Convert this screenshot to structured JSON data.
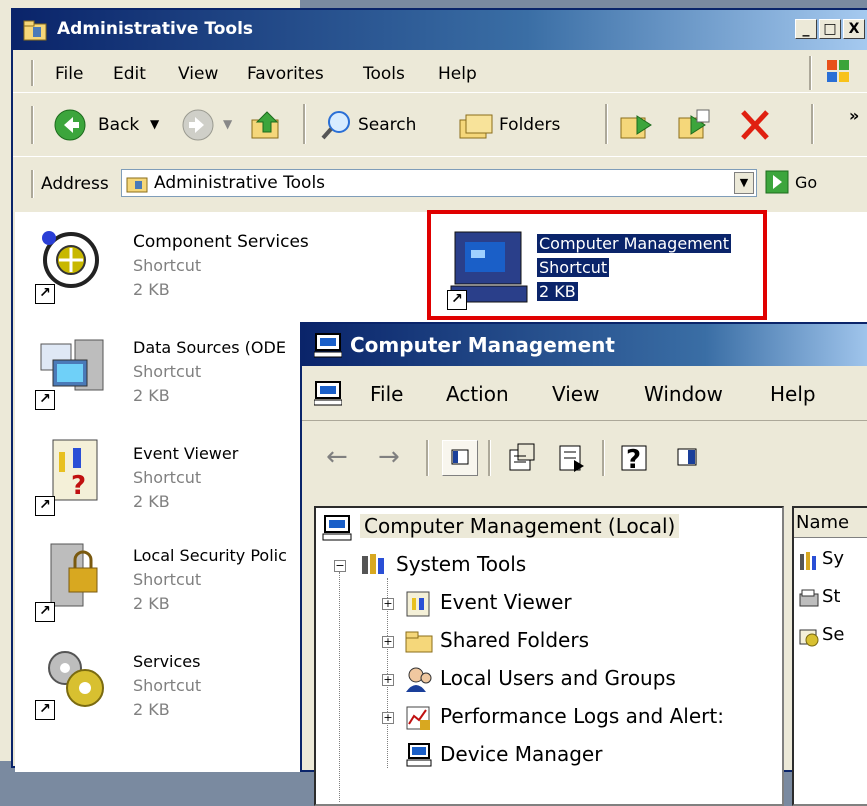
{
  "admin_window": {
    "title": "Administrative Tools",
    "controls": {
      "minimize": "_",
      "maximize": "□",
      "close": "X"
    },
    "menu": [
      "File",
      "Edit",
      "View",
      "Favorites",
      "Tools",
      "Help"
    ],
    "toolbar": {
      "back": "Back",
      "search": "Search",
      "folders": "Folders",
      "more": "»"
    },
    "address": {
      "label": "Address",
      "value": "Administrative Tools",
      "go": "Go"
    },
    "items": [
      {
        "name": "Component Services",
        "type": "Shortcut",
        "size": "2 KB"
      },
      {
        "name": "Data Sources (ODE",
        "type": "Shortcut",
        "size": "2 KB"
      },
      {
        "name": "Event Viewer",
        "type": "Shortcut",
        "size": "2 KB"
      },
      {
        "name": "Local Security Polic",
        "type": "Shortcut",
        "size": "2 KB"
      },
      {
        "name": "Services",
        "type": "Shortcut",
        "size": "2 KB"
      }
    ],
    "selected_item": {
      "name": "Computer Management",
      "type": "Shortcut",
      "size": "2 KB"
    }
  },
  "cm_window": {
    "title": "Computer Management",
    "menu": [
      "File",
      "Action",
      "View",
      "Window",
      "Help"
    ],
    "tree": {
      "root": "Computer Management (Local)",
      "system_tools": "System Tools",
      "children": [
        "Event Viewer",
        "Shared Folders",
        "Local Users and Groups",
        "Performance Logs and Alert:",
        "Device Manager"
      ]
    },
    "right_pane": {
      "column_header": "Name",
      "rows": [
        "Sy",
        "St",
        "Se"
      ]
    }
  },
  "colors": {
    "title_bar": "#0a246a",
    "selection": "#0a246a",
    "highlight_box": "#e00000",
    "window_bg": "#ece9d8"
  }
}
